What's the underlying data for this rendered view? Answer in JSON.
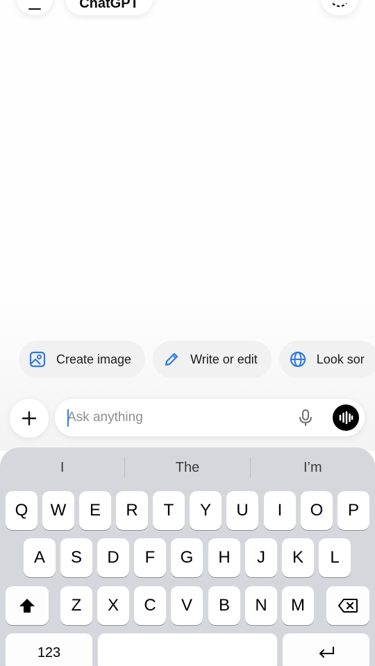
{
  "header": {
    "title": "ChatGPT"
  },
  "chips": [
    {
      "label": "Create image",
      "icon": "image-icon"
    },
    {
      "label": "Write or edit",
      "icon": "pencil-icon"
    },
    {
      "label": "Look sor",
      "icon": "globe-icon"
    }
  ],
  "composer": {
    "placeholder": "Ask anything"
  },
  "keyboard": {
    "suggestions": [
      "I",
      "The",
      "I’m"
    ],
    "row1": [
      "Q",
      "W",
      "E",
      "R",
      "T",
      "Y",
      "U",
      "I",
      "O",
      "P"
    ],
    "row2": [
      "A",
      "S",
      "D",
      "F",
      "G",
      "H",
      "J",
      "K",
      "L"
    ],
    "row3": [
      "Z",
      "X",
      "C",
      "V",
      "B",
      "N",
      "M"
    ],
    "numbers_label": "123"
  },
  "colors": {
    "accent_blue": "#2c7be5",
    "keyboard_bg": "#d5d7dc",
    "cursor": "#2f7cf6"
  }
}
